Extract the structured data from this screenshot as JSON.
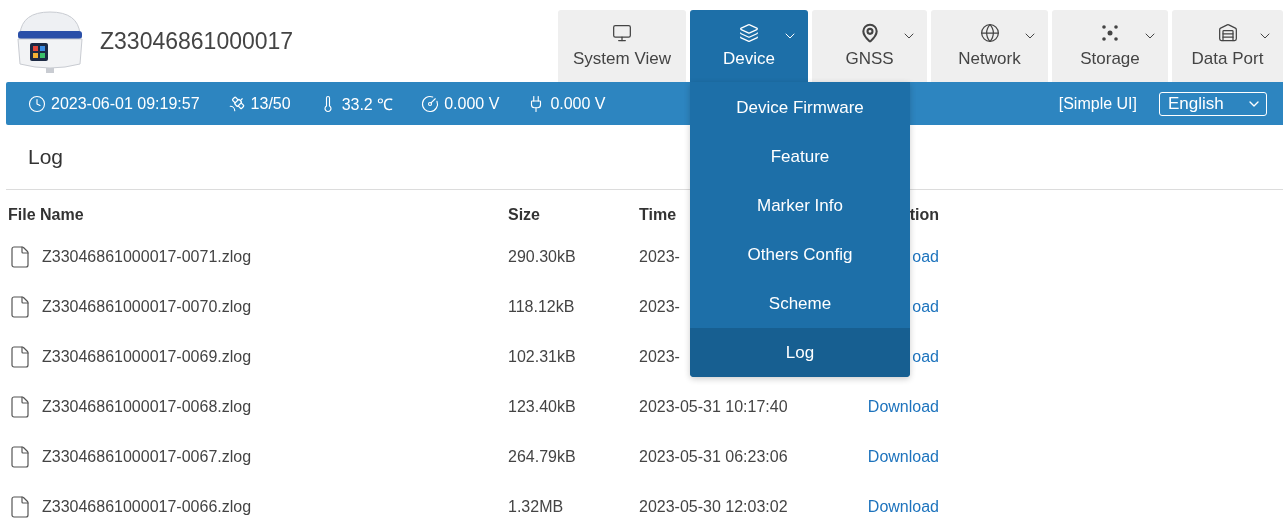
{
  "device": {
    "serial": "Z33046861000017"
  },
  "nav_tabs": [
    {
      "kind": "chart",
      "label": "System View",
      "selected": false,
      "dropdown": false
    },
    {
      "kind": "layers",
      "label": "Device",
      "selected": true,
      "dropdown": true
    },
    {
      "kind": "pin",
      "label": "GNSS",
      "selected": false,
      "dropdown": true
    },
    {
      "kind": "globe",
      "label": "Network",
      "selected": false,
      "dropdown": true
    },
    {
      "kind": "dots",
      "label": "Storage",
      "selected": false,
      "dropdown": true
    },
    {
      "kind": "house",
      "label": "Data Port",
      "selected": false,
      "dropdown": true
    }
  ],
  "status_bar": {
    "items": [
      {
        "kind": "clock",
        "text": "2023-06-01 09:19:57"
      },
      {
        "kind": "satellite",
        "text": "13/50"
      },
      {
        "kind": "thermometer",
        "text": "33.2 ℃"
      },
      {
        "kind": "power",
        "text": "0.000 V"
      },
      {
        "kind": "port",
        "text": "0.000 V"
      }
    ],
    "simple_ui": "[Simple UI]",
    "language": "English"
  },
  "device_menu": {
    "items": [
      {
        "label": "Device Firmware",
        "selected": false
      },
      {
        "label": "Feature",
        "selected": false
      },
      {
        "label": "Marker Info",
        "selected": false
      },
      {
        "label": "Others Config",
        "selected": false
      },
      {
        "label": "Scheme",
        "selected": false
      },
      {
        "label": "Log",
        "selected": true
      }
    ]
  },
  "page_title": "Log",
  "table": {
    "columns": [
      "File Name",
      "Size",
      "Time",
      "tion"
    ],
    "rows": [
      {
        "name": "Z33046861000017-0071.zlog",
        "size": "290.30kB",
        "time": "2023-",
        "action": "oad"
      },
      {
        "name": "Z33046861000017-0070.zlog",
        "size": "118.12kB",
        "time": "2023-",
        "action": "oad"
      },
      {
        "name": "Z33046861000017-0069.zlog",
        "size": "102.31kB",
        "time": "2023-",
        "action": "oad"
      },
      {
        "name": "Z33046861000017-0068.zlog",
        "size": "123.40kB",
        "time": "2023-05-31 10:17:40",
        "action": "Download"
      },
      {
        "name": "Z33046861000017-0067.zlog",
        "size": "264.79kB",
        "time": "2023-05-31 06:23:06",
        "action": "Download"
      },
      {
        "name": "Z33046861000017-0066.zlog",
        "size": "1.32MB",
        "time": "2023-05-30 12:03:02",
        "action": "Download"
      }
    ]
  }
}
